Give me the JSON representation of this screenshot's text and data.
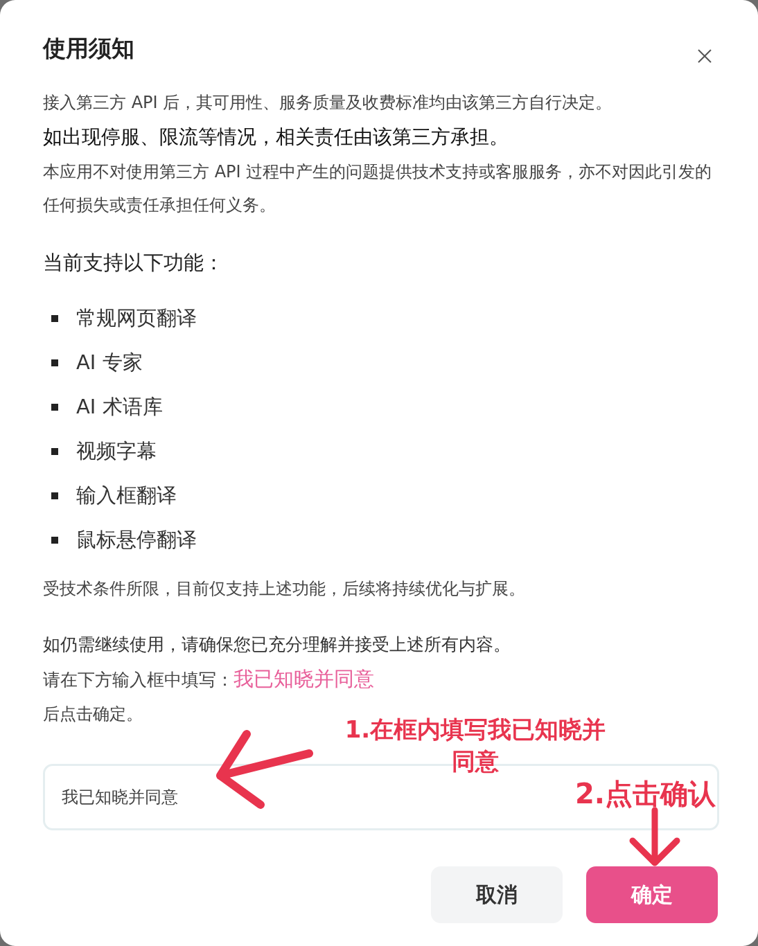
{
  "dialog": {
    "title": "使用须知",
    "intro": [
      {
        "kind": "small",
        "text": "接入第三方 API 后，其可用性、服务质量及收费标准均由该第三方自行决定。"
      },
      {
        "kind": "large",
        "text": "如出现停服、限流等情况，相关责任由该第三方承担。"
      },
      {
        "kind": "small",
        "text": "本应用不对使用第三方 API 过程中产生的问题提供技术支持或客服服务，亦不对因此引发的任何损失或责任承担任何义务。"
      }
    ],
    "features_heading": "当前支持以下功能：",
    "features": [
      "常规网页翻译",
      "AI 专家",
      "AI 术语库",
      "视频字幕",
      "输入框翻译",
      "鼠标悬停翻译"
    ],
    "note": "受技术条件所限，目前仅支持上述功能，后续将持续优化与扩展。",
    "confirm_text": "如仍需继续使用，请确保您已充分理解并接受上述所有内容。",
    "instruction_label": "请在下方输入框中填写：",
    "required_phrase": "我已知晓并同意",
    "after_text": "后点击确定。",
    "input": {
      "value": "我已知晓并同意"
    },
    "buttons": [
      {
        "label": "取消",
        "kind": "secondary"
      },
      {
        "label": "确定",
        "kind": "primary"
      }
    ]
  },
  "annotations": [
    {
      "kind": "step-input",
      "text": "1.在框内填写我已知晓并同意"
    },
    {
      "kind": "step-button",
      "text": "2.点击确认"
    }
  ]
}
